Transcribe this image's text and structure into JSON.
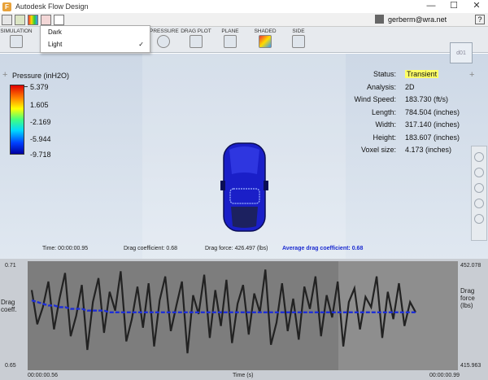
{
  "window": {
    "title": "Autodesk Flow Design",
    "minimize": "—",
    "maximize": "☐",
    "close": "✕"
  },
  "user": {
    "email": "gerberm@wra.net"
  },
  "help": "?",
  "ribbon": {
    "tabs": [
      "SIMULATION",
      "PRESSURE",
      "DRAG PLOT",
      "PLANE",
      "SHADED",
      "SIDE"
    ]
  },
  "theme_menu": {
    "options": [
      "Dark",
      "Light"
    ],
    "checked": "Light",
    "checkmark": "✓"
  },
  "legend": {
    "title": "Pressure (inH2O)",
    "values": [
      "5.379",
      "1.605",
      "-2.169",
      "-5.944",
      "-9.718"
    ]
  },
  "status": {
    "rows": [
      {
        "key": "Status:",
        "value": "Transient"
      },
      {
        "key": "Analysis:",
        "value": "2D"
      },
      {
        "key": "Wind Speed:",
        "value": "183.730 (ft/s)"
      },
      {
        "key": "Length:",
        "value": "784.504 (inches)"
      },
      {
        "key": "Width:",
        "value": "317.140 (inches)"
      },
      {
        "key": "Height:",
        "value": "183.607 (inches)"
      },
      {
        "key": "Voxel size:",
        "value": "4.173 (inches)"
      }
    ]
  },
  "view_cube": {
    "label": "d01"
  },
  "readout": {
    "time": "Time: 00:00:00.95",
    "drag_coefficient": "Drag coefficient: 0.68",
    "drag_force": "Drag force: 426.497 (lbs)",
    "avg_drag": "Average drag coefficient: 0.68"
  },
  "chart_data": {
    "type": "line",
    "title": "",
    "xlabel": "Time (s)",
    "x_range": [
      "00:00:00.56",
      "00:00:00.99"
    ],
    "y_left_label": "Drag coeff.",
    "y_left_range": [
      0.65,
      0.71
    ],
    "y_right_label": "Drag force (lbs)",
    "y_right_range": [
      415.963,
      452.078
    ],
    "series": [
      {
        "color": "#222222",
        "values": [
          0.695,
          0.675,
          0.685,
          0.7,
          0.672,
          0.69,
          0.705,
          0.668,
          0.68,
          0.698,
          0.66,
          0.688,
          0.702,
          0.67,
          0.694,
          0.683,
          0.706,
          0.665,
          0.678,
          0.697,
          0.673,
          0.699,
          0.662,
          0.689,
          0.703,
          0.671,
          0.686,
          0.7,
          0.658,
          0.692,
          0.681,
          0.704,
          0.667,
          0.695,
          0.674,
          0.701,
          0.664,
          0.687,
          0.698,
          0.669,
          0.693,
          0.682,
          0.707,
          0.663,
          0.676,
          0.699,
          0.671,
          0.69,
          0.666,
          0.697,
          0.684,
          0.703,
          0.668,
          0.692,
          0.679,
          0.7,
          0.662,
          0.688,
          0.696,
          0.672,
          0.691,
          0.685,
          0.703,
          0.667,
          0.694,
          0.678,
          0.699,
          0.674,
          0.688,
          0.682
        ]
      },
      {
        "color": "#1e2fd6",
        "values": [
          0.689,
          0.688,
          0.687,
          0.686,
          0.686,
          0.685,
          0.685,
          0.684,
          0.684,
          0.684,
          0.683,
          0.683,
          0.683,
          0.683,
          0.682,
          0.682,
          0.682,
          0.682,
          0.682,
          0.682,
          0.682,
          0.682,
          0.682,
          0.682,
          0.682,
          0.682,
          0.682,
          0.682,
          0.682,
          0.682,
          0.682,
          0.682,
          0.682,
          0.682,
          0.682,
          0.682,
          0.682,
          0.682,
          0.682,
          0.682,
          0.682,
          0.682,
          0.682,
          0.682,
          0.682,
          0.682,
          0.682,
          0.682,
          0.682,
          0.682,
          0.682,
          0.682,
          0.682,
          0.682,
          0.682,
          0.682,
          0.682,
          0.682,
          0.682,
          0.682,
          0.682,
          0.682,
          0.682,
          0.682,
          0.682,
          0.682,
          0.682,
          0.682,
          0.682,
          0.682
        ]
      }
    ]
  }
}
